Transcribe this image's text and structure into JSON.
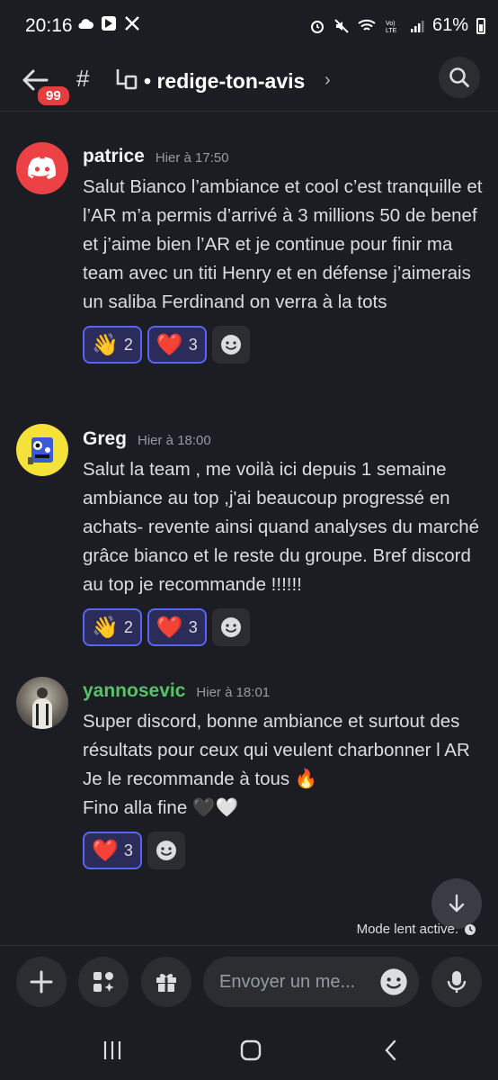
{
  "status": {
    "time": "20:16",
    "battery": "61%",
    "left_icons": [
      "cloud-icon",
      "app-icon",
      "x-icon"
    ],
    "right_icons": [
      "alarm-icon",
      "mute-icon",
      "wifi-call-icon",
      "volte-icon",
      "signal-icon",
      "battery-icon"
    ]
  },
  "header": {
    "badge": "99",
    "channel_name": "redige-ton-avis",
    "bullet": "•",
    "chevron": "›"
  },
  "messages": [
    {
      "author": "patrice",
      "timestamp": "Hier à 17:50",
      "text": "Salut Bianco l’ambiance et cool c’est tranquille et l’AR m’a permis d’arrivé à 3 millions 50 de benef et j’aime bien l’AR et je continue pour finir ma team avec un titi Henry et en défense j’aimerais un saliba Ferdinand on verra à la tots",
      "reactions": [
        {
          "emoji": "👋",
          "count": "2"
        },
        {
          "emoji": "❤️",
          "count": "3"
        }
      ]
    },
    {
      "author": "Greg",
      "timestamp": "Hier à 18:00",
      "text": "Salut la team , me voilà ici depuis 1 semaine ambiance au top ,j'ai beaucoup progressé en achats- revente ainsi quand analyses du marché grâce bianco et le reste du groupe. Bref discord au top je recommande !!!!!!",
      "reactions": [
        {
          "emoji": "👋",
          "count": "2"
        },
        {
          "emoji": "❤️",
          "count": "3"
        }
      ]
    },
    {
      "author": "yannosevic",
      "timestamp": "Hier à 18:01",
      "text": "Super discord, bonne ambiance et surtout des résultats pour ceux qui veulent charbonner l AR\nJe le recommande à tous 🔥\nFino alla fine 🖤🤍",
      "reactions": [
        {
          "emoji": "❤️",
          "count": "3"
        }
      ]
    }
  ],
  "slowmode": "Mode lent active.",
  "composer": {
    "placeholder": "Envoyer un me..."
  },
  "colors": {
    "background": "#1c1d22",
    "accent": "#5865f2",
    "badge": "#e53e3e",
    "username_green": "#57c26a",
    "discord_red": "#ed4245"
  }
}
